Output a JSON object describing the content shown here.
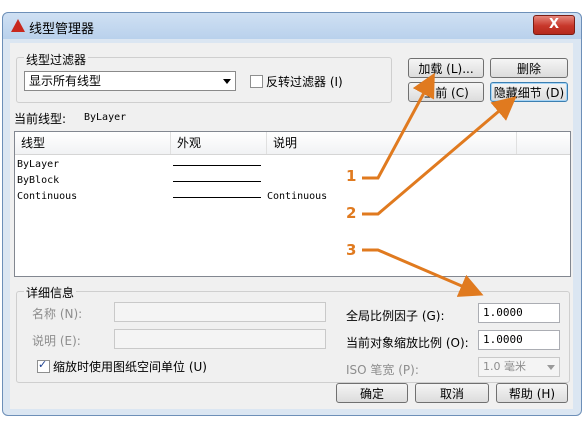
{
  "window": {
    "title": "线型管理器",
    "close_label": "X"
  },
  "filter": {
    "group_label": "线型过滤器",
    "selected": "显示所有线型",
    "invert_label": "反转过滤器 (I)",
    "invert_checked": false
  },
  "buttons": {
    "load": "加载 (L)...",
    "delete": "删除",
    "current": "当前 (C)",
    "hide_details": "隐藏细节 (D)"
  },
  "current_linetype": {
    "label": "当前线型:",
    "value": "ByLayer"
  },
  "list": {
    "columns": [
      "线型",
      "外观",
      "说明"
    ],
    "rows": [
      {
        "name": "ByLayer",
        "description": ""
      },
      {
        "name": "ByBlock",
        "description": ""
      },
      {
        "name": "Continuous",
        "description": "Continuous"
      }
    ]
  },
  "details": {
    "group_label": "详细信息",
    "name_label": "名称 (N):",
    "desc_label": "说明 (E):",
    "paper_space_label": "缩放时使用图纸空间单位 (U)",
    "paper_space_checked": true,
    "global_scale_label": "全局比例因子 (G):",
    "global_scale_value": "1.0000",
    "object_scale_label": "当前对象缩放比例 (O):",
    "object_scale_value": "1.0000",
    "pen_width_label": "ISO 笔宽 (P):",
    "pen_width_value": "1.0 毫米"
  },
  "footer": {
    "ok": "确定",
    "cancel": "取消",
    "help": "帮助 (H)"
  },
  "annotations": [
    "1",
    "2",
    "3"
  ],
  "colors": {
    "accent": "#e07a1f",
    "title_bar": "#b9d1ec",
    "close": "#c7372a"
  }
}
